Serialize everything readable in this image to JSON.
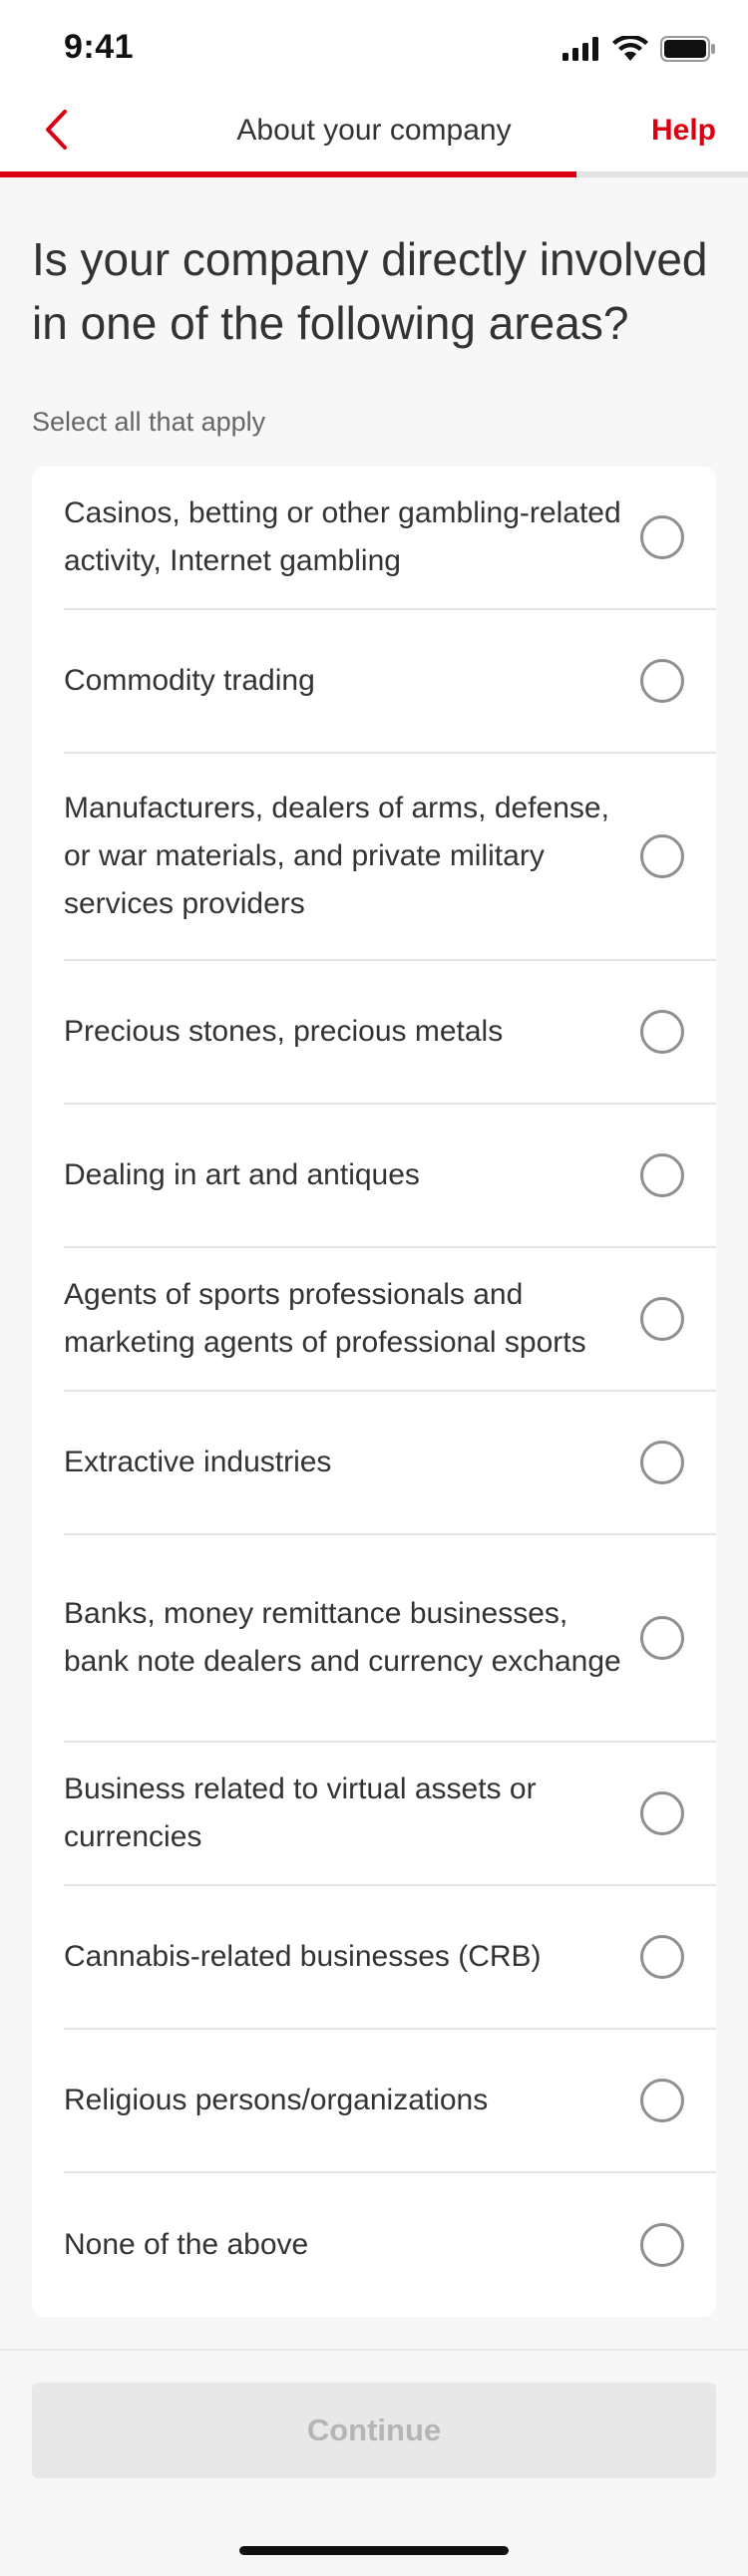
{
  "status_bar": {
    "time": "9:41",
    "icons": [
      "signal-icon",
      "wifi-icon",
      "battery-icon"
    ]
  },
  "nav": {
    "back_icon": "chevron-left-icon",
    "title": "About your company",
    "help_label": "Help",
    "progress_fraction": 0.77
  },
  "question": {
    "title": "Is your company directly involved in one of the following areas?",
    "hint": "Select all that apply"
  },
  "options": [
    {
      "label": "Casinos, betting or other gambling-related activity, Internet gambling",
      "selected": false
    },
    {
      "label": "Commodity trading",
      "selected": false
    },
    {
      "label": "Manufacturers, dealers of arms, defense, or war materials, and private military services providers",
      "selected": false
    },
    {
      "label": "Precious stones, precious metals",
      "selected": false
    },
    {
      "label": "Dealing in art and antiques",
      "selected": false
    },
    {
      "label": "Agents of sports professionals and marketing agents of professional sports",
      "selected": false
    },
    {
      "label": "Extractive industries",
      "selected": false
    },
    {
      "label": "Banks, money remittance businesses, bank note dealers and currency exchange",
      "selected": false
    },
    {
      "label": "Business related to virtual assets or currencies",
      "selected": false
    },
    {
      "label": "Cannabis-related businesses (CRB)",
      "selected": false
    },
    {
      "label": "Religious persons/organizations",
      "selected": false
    },
    {
      "label": "None of the above",
      "selected": false
    }
  ],
  "footer": {
    "continue_label": "Continue",
    "continue_enabled": false
  },
  "colors": {
    "accent": "#db0011",
    "background": "#f7f7f7",
    "disabled_button": "#e8e8e8"
  }
}
